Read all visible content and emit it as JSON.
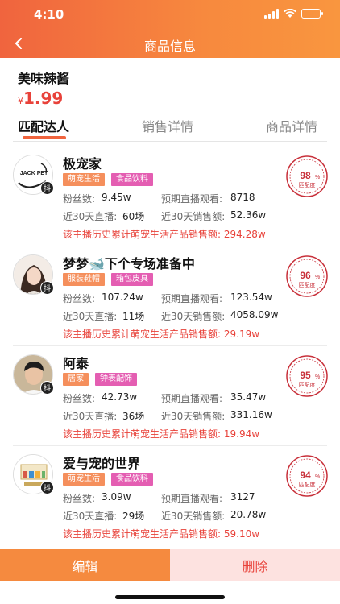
{
  "status_bar": {
    "time": "4:10"
  },
  "nav": {
    "title": "商品信息"
  },
  "product": {
    "name": "美味辣酱",
    "price_symbol": "¥",
    "price": "1.99"
  },
  "tabs": [
    {
      "label": "匹配达人",
      "active": true
    },
    {
      "label": "销售详情",
      "active": false
    },
    {
      "label": "商品详情",
      "active": false
    }
  ],
  "labels": {
    "fans": "粉丝数:",
    "live30": "近30天直播:",
    "expected_views": "预期直播观看:",
    "sales30": "近30天销售额:",
    "match_text": "匹配度"
  },
  "influencers": [
    {
      "name": "极宠家",
      "avatar_text": "JACK PET",
      "tags": [
        {
          "text": "萌宠生活",
          "color": "#f58f5c"
        },
        {
          "text": "食品饮料",
          "color": "#e45eb2"
        }
      ],
      "fans": "9.45w",
      "live30": "60场",
      "expected_views": "8718",
      "sales30": "52.36w",
      "history": "该主播历史累计萌宠生活产品销售额: 294.28w",
      "match_pct": "98",
      "match_level": 0.98
    },
    {
      "name": "梦梦🐋下个专场准备中",
      "avatar_text": "",
      "tags": [
        {
          "text": "服装鞋帽",
          "color": "#f58f5c"
        },
        {
          "text": "箱包皮具",
          "color": "#e45eb2"
        }
      ],
      "fans": "107.24w",
      "live30": "11场",
      "expected_views": "123.54w",
      "sales30": "4058.09w",
      "history": "该主播历史累计萌宠生活产品销售额: 29.19w",
      "match_pct": "96",
      "match_level": 0.96
    },
    {
      "name": "阿泰",
      "avatar_text": "",
      "tags": [
        {
          "text": "居家",
          "color": "#f58f5c"
        },
        {
          "text": "钟表配饰",
          "color": "#e45eb2"
        }
      ],
      "fans": "42.73w",
      "live30": "36场",
      "expected_views": "35.47w",
      "sales30": "331.16w",
      "history": "该主播历史累计萌宠生活产品销售额: 19.94w",
      "match_pct": "95",
      "match_level": 0.95
    },
    {
      "name": "爱与宠的世界",
      "avatar_text": "",
      "tags": [
        {
          "text": "萌宠生活",
          "color": "#f58f5c"
        },
        {
          "text": "食品饮料",
          "color": "#e45eb2"
        }
      ],
      "fans": "3.09w",
      "live30": "29场",
      "expected_views": "3127",
      "sales30": "20.78w",
      "history": "该主播历史累计萌宠生活产品销售额: 59.10w",
      "match_pct": "94",
      "match_level": 0.94
    }
  ],
  "actions": {
    "edit": "编辑",
    "delete": "删除"
  },
  "colors": {
    "accent": "#f0643e",
    "price_red": "#e8423a",
    "stamp_red": "#c8303a",
    "tag_orange": "#f58f5c",
    "tag_pink": "#e45eb2"
  }
}
